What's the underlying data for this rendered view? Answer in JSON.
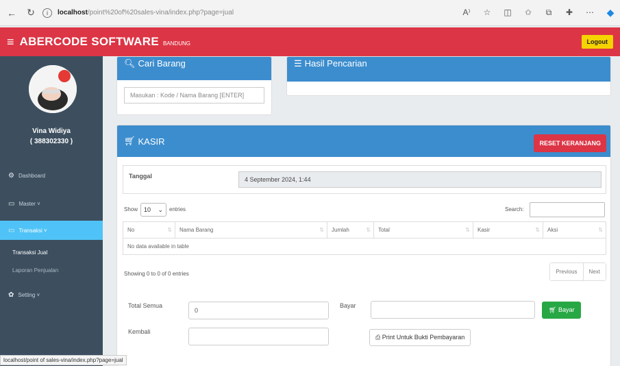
{
  "browser": {
    "url_host": "localhost",
    "url_path": "/point%20of%20sales-vina/index.php?page=jual",
    "status_url": "localhost/point of sales-vina/index.php?page=jual"
  },
  "header": {
    "brand": "ABERCODE SOFTWARE",
    "brand_sub": "BANDUNG",
    "logout_label": "Logout"
  },
  "sidebar": {
    "user_name": "Vina Widiya",
    "user_id": "( 388302330 )",
    "items": [
      {
        "label": "Dashboard",
        "icon": "dashboard-icon"
      },
      {
        "label": "Master ˅",
        "icon": "monitor-icon"
      },
      {
        "label": "Transaksi ˅",
        "icon": "monitor-icon"
      },
      {
        "label": "Setting ˅",
        "icon": "gear-icon"
      }
    ],
    "submenu": [
      "Transaksi Jual",
      "Laporan Penjualan"
    ]
  },
  "search_card": {
    "title": "Cari Barang",
    "placeholder": "Masukan : Kode / Nama Barang  [ENTER]"
  },
  "result_card": {
    "title": "Hasil Pencarian"
  },
  "kasir": {
    "title": "KASIR",
    "reset_label": "RESET KERANJANG",
    "tanggal_label": "Tanggal",
    "tanggal_value": "4 September 2024, 1:44",
    "show_label": "Show",
    "entries_value": "10",
    "entries_label": "entries",
    "search_label": "Search:",
    "columns": [
      "No",
      "Nama Barang",
      "Jumlah",
      "Total",
      "Kasir",
      "Aksi"
    ],
    "empty_text": "No data available in table",
    "info_text": "Showing 0 to 0 of 0 entries",
    "prev_label": "Previous",
    "next_label": "Next",
    "total_label": "Total Semua",
    "total_value": "0",
    "bayar_label": "Bayar",
    "bayar_button": "Bayar",
    "kembali_label": "Kembali",
    "print_button": "Print Untuk Bukti Pembayaran"
  },
  "colors": {
    "header": "#dc3545",
    "sidebar": "#3d4f5f",
    "card_head": "#3c8dce",
    "logout": "#f5d300",
    "bayar": "#28a745"
  }
}
